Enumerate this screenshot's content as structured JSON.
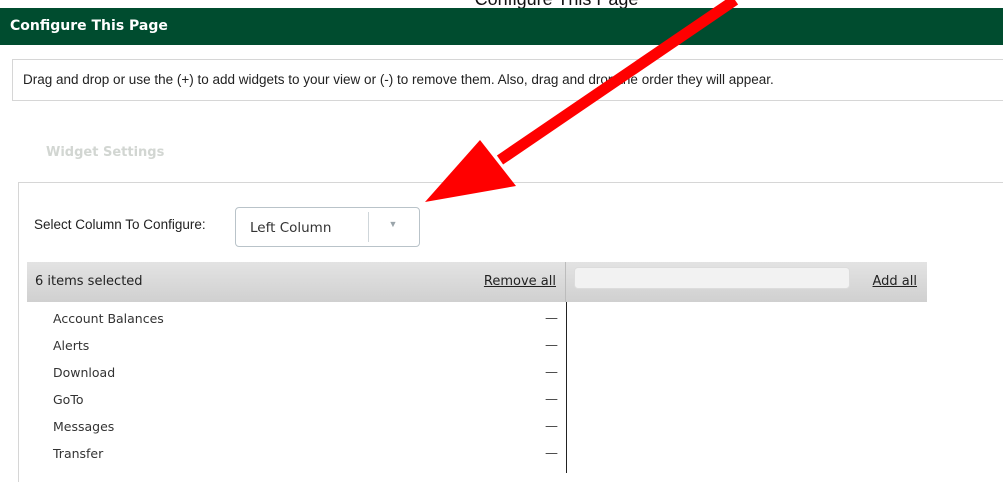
{
  "caption": {
    "partial_text": "Configure This Page"
  },
  "header": {
    "title": "Configure This Page"
  },
  "instructions": {
    "text": "Drag and drop or use the (+) to add widgets to your view or (-) to remove them. Also, drag and drop the order they will appear."
  },
  "section": {
    "title": "Widget Settings"
  },
  "column_select": {
    "label": "Select Column To Configure:",
    "value": "Left Column",
    "caret_icon": "chevron-down-icon"
  },
  "selected_list": {
    "count_label": "6 items selected",
    "remove_all_label": "Remove all",
    "remove_icon": "minus-icon",
    "items": [
      {
        "label": "Account Balances",
        "action": "—"
      },
      {
        "label": "Alerts",
        "action": "—"
      },
      {
        "label": "Download",
        "action": "—"
      },
      {
        "label": "GoTo",
        "action": "—"
      },
      {
        "label": "Messages",
        "action": "—"
      },
      {
        "label": "Transfer",
        "action": "—"
      }
    ]
  },
  "available_list": {
    "search_value": "",
    "add_all_label": "Add all"
  },
  "annotation": {
    "arrow_color": "#ff0000"
  },
  "colors": {
    "header_bg": "#004c2f",
    "header_text": "#ffffff",
    "section_title": "#d2d6d2"
  }
}
